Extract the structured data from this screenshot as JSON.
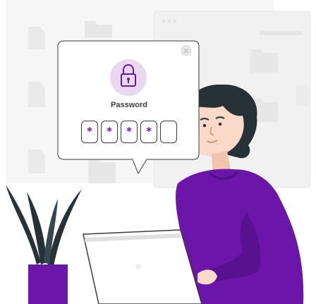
{
  "dialog": {
    "title": "Password",
    "slots": [
      "*",
      "*",
      "*",
      "*",
      ""
    ]
  },
  "colors": {
    "accent": "#6b16a8",
    "accent_light": "#e8d9f1",
    "skin": "#fad9c8",
    "hair": "#263238",
    "background_shapes": "#f2f2f2",
    "outline": "#3b3b3b"
  },
  "icons": [
    "lock-icon",
    "close-icon",
    "folder-icon",
    "document-icon"
  ]
}
